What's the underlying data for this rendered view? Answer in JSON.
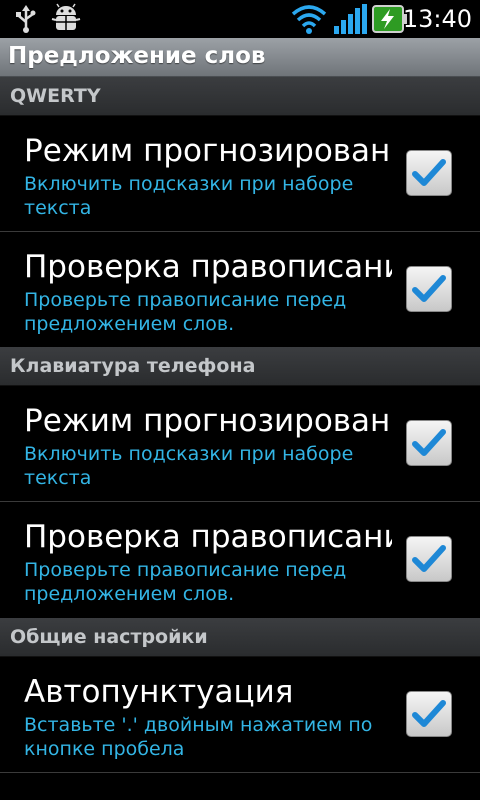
{
  "status_bar": {
    "time": "13:40",
    "icons": [
      "usb-icon",
      "android-debug-icon",
      "wifi-icon",
      "signal-icon",
      "battery-charging-icon"
    ]
  },
  "title": "Предложение слов",
  "sections": [
    {
      "header": "QWERTY",
      "items": [
        {
          "title": "Режим прогнозирования",
          "summary": "Включить подсказки при наборе текста",
          "checked": true
        },
        {
          "title": "Проверка правописания",
          "summary": "Проверьте правописание перед предложением слов.",
          "checked": true
        }
      ]
    },
    {
      "header": "Клавиатура телефона",
      "items": [
        {
          "title": "Режим прогнозирования",
          "summary": "Включить подсказки при наборе текста",
          "checked": true
        },
        {
          "title": "Проверка правописания",
          "summary": "Проверьте правописание перед предложением слов.",
          "checked": true
        }
      ]
    },
    {
      "header": "Общие настройки",
      "items": [
        {
          "title": "Автопунктуация",
          "summary": "Вставьте '.' двойным нажатием по кнопке пробела",
          "checked": true
        }
      ]
    }
  ],
  "colors": {
    "summary_text": "#33b5e5",
    "check_mark": "#1e88d6"
  }
}
